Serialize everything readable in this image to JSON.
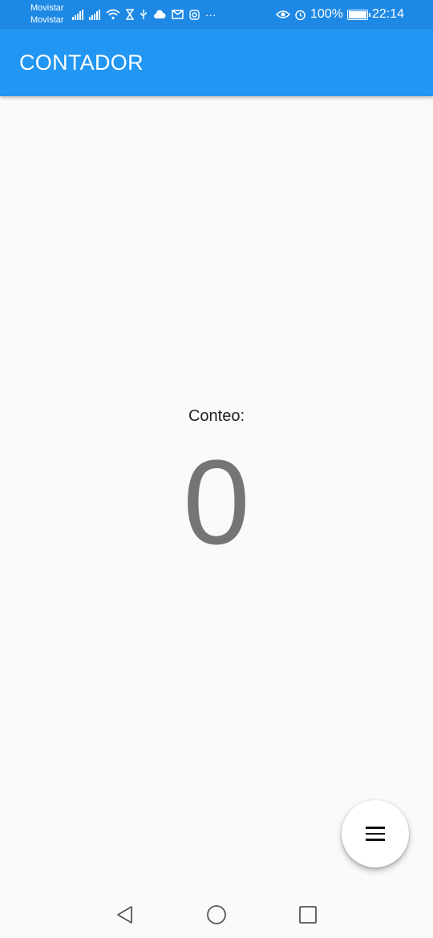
{
  "status_bar": {
    "carrier_1": "Movistar",
    "carrier_2": "Movistar",
    "more": "···",
    "battery_percent": "100%",
    "time": "22:14"
  },
  "app_bar": {
    "title": "CONTADOR",
    "color": "#2196f3"
  },
  "counter": {
    "label": "Conteo:",
    "value": "0"
  },
  "fab": {
    "icon": "menu-icon"
  },
  "nav_bar": {
    "back_icon": "back-triangle-icon",
    "home_icon": "home-circle-icon",
    "recents_icon": "recents-square-icon"
  }
}
